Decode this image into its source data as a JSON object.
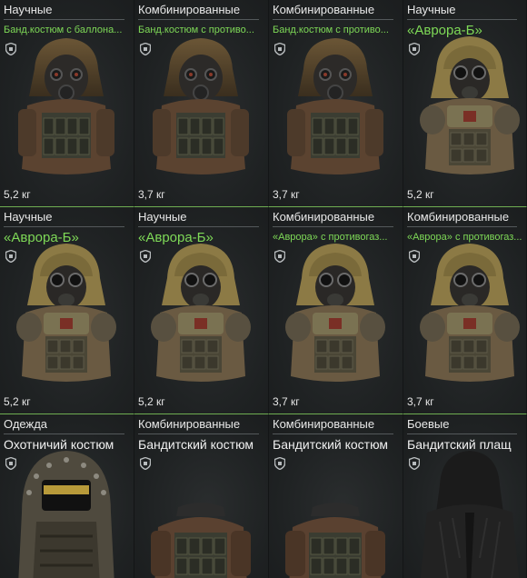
{
  "colors": {
    "accent_green": "#7ed957",
    "card_bg": "#1f2223",
    "divider_green": "#6fae52"
  },
  "items": [
    {
      "category": "Научные",
      "name": "Банд.костюм с баллона...",
      "name_style": "small",
      "weight": "5,2 кг",
      "art": "hood-gasmask-vest-icon"
    },
    {
      "category": "Комбинированные",
      "name": "Банд.костюм с противо...",
      "name_style": "small",
      "weight": "3,7 кг",
      "art": "hood-gasmask-vest-icon"
    },
    {
      "category": "Комбинированные",
      "name": "Банд.костюм с противо...",
      "name_style": "small",
      "weight": "3,7 кг",
      "art": "hood-gasmask-vest-icon"
    },
    {
      "category": "Научные",
      "name": "«Аврора-Б»",
      "name_style": "large",
      "weight": "5,2 кг",
      "art": "hood-goggles-armor-icon"
    },
    {
      "category": "Научные",
      "name": "«Аврора-Б»",
      "name_style": "large",
      "weight": "5,2 кг",
      "art": "hood-goggles-armor-icon"
    },
    {
      "category": "Научные",
      "name": "«Аврора-Б»",
      "name_style": "large",
      "weight": "5,2 кг",
      "art": "hood-goggles-armor-icon"
    },
    {
      "category": "Комбинированные",
      "name": "«Аврора» с противогаз...",
      "name_style": "small",
      "weight": "3,7 кг",
      "art": "hood-goggles-armor-icon"
    },
    {
      "category": "Комбинированные",
      "name": "«Аврора» с противогаз...",
      "name_style": "small",
      "weight": "3,7 кг",
      "art": "hood-goggles-armor-icon"
    },
    {
      "category": "Одежда",
      "name": "Охотничий костюм",
      "name_style": "white",
      "weight": "",
      "art": "spiked-hood-jacket-icon"
    },
    {
      "category": "Комбинированные",
      "name": "Бандитский костюм",
      "name_style": "white",
      "weight": "",
      "art": "leather-vest-icon"
    },
    {
      "category": "Комбинированные",
      "name": "Бандитский костюм",
      "name_style": "white",
      "weight": "",
      "art": "leather-vest-icon"
    },
    {
      "category": "Боевые",
      "name": "Бандитский плащ",
      "name_style": "white",
      "weight": "",
      "art": "black-coat-icon"
    }
  ]
}
